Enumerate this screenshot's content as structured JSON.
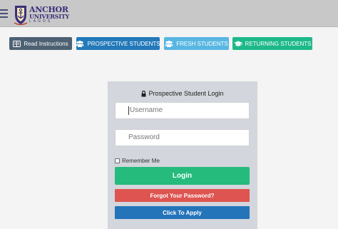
{
  "header": {
    "logo": {
      "line1": "ANCHOR",
      "line2": "UNIVERSITY",
      "line3": "LAGOS"
    }
  },
  "nav": {
    "read_instructions": "Read Instructions",
    "prospective_students": "PROSPECTIVE STUDENTS",
    "fresh_students": "FRESH STUDENTS",
    "returning_students": "RETURNING STUDENTS"
  },
  "login_panel": {
    "title": "Prospective Student Login",
    "username_placeholder": "Username",
    "password_placeholder": "Password",
    "remember_label": "Remember Me",
    "remember_checked": false,
    "login_label": "Login",
    "forgot_label": "Forgot Your Password?",
    "apply_label": "Click To Apply"
  },
  "colors": {
    "topbar": "#c8c8c8",
    "read_btn": "#4d6173",
    "prospective_btn": "#2379b9",
    "fresh_btn": "#58b6e2",
    "returning_btn": "#1db98a",
    "login_btn": "#24bb7d",
    "forgot_btn": "#de5450",
    "apply_btn": "#2474ba"
  },
  "icons": {
    "menu": "hamburger-icon",
    "read": "book-icon",
    "prospective": "users-icon",
    "fresh": "users-icon",
    "returning": "graduation-cap-icon",
    "title": "lock-icon"
  }
}
